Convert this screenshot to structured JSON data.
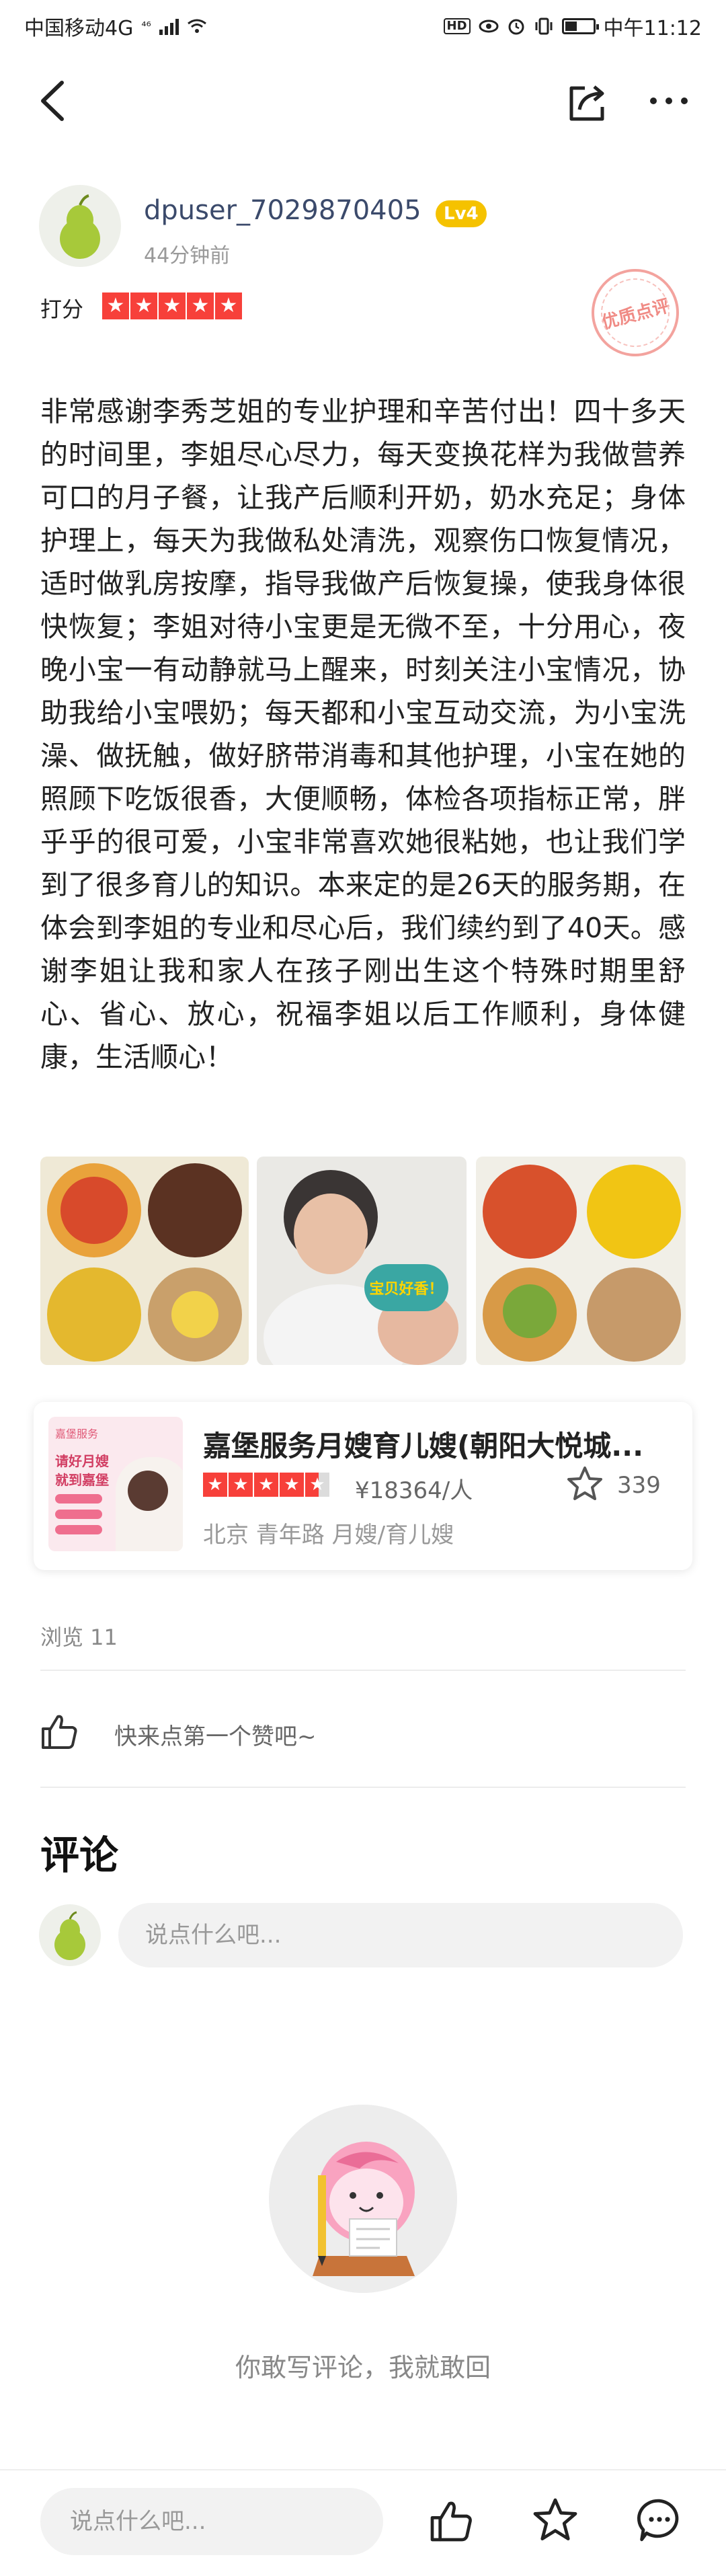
{
  "status_bar": {
    "carrier": "中国移动4G",
    "network": "⁴⁶",
    "time": "中午11:12",
    "hd": "HD"
  },
  "author": {
    "username": "dpuser_7029870405",
    "level": "Lv4",
    "time_ago": "44分钟前",
    "rating_label": "打分",
    "rating": 5,
    "stamp": "优质点评"
  },
  "review": {
    "text": "非常感谢李秀芝姐的专业护理和辛苦付出！四十多天的时间里，李姐尽心尽力，每天变换花样为我做营养可口的月子餐，让我产后顺利开奶，奶水充足；身体护理上，每天为我做私处清洗，观察伤口恢复情况，适时做乳房按摩，指导我做产后恢复操，使我身体很快恢复；李姐对待小宝更是无微不至，十分用心，夜晚小宝一有动静就马上醒来，时刻关注小宝情况，协助我给小宝喂奶；每天都和小宝互动交流，为小宝洗澡、做抚触，做好脐带消毒和其他护理，小宝在她的照顾下吃饭很香，大便顺畅，体检各项指标正常，胖乎乎的很可爱，小宝非常喜欢她很粘她，也让我们学到了很多育儿的知识。本来定的是26天的服务期，在体会到李姐的专业和尽心后，我们续约到了40天。感谢李姐让我和家人在孩子刚出生这个特殊时期里舒心、省心、放心，祝福李姐以后工作顺利，身体健康，生活顺心！"
  },
  "photos": {
    "bubble_text": "宝贝好香！"
  },
  "shop": {
    "name": "嘉堡服务月嫂育儿嫂(朝阳大悦城...",
    "rating": 4.5,
    "price": "¥18364/人",
    "favorites": "339",
    "location": "北京 青年路 月嫂/育儿嫂",
    "thumb_lines": [
      "请好月嫂",
      "就到嘉堡"
    ],
    "thumb_brand": "嘉堡服务"
  },
  "stats": {
    "views": "浏览 11",
    "like_prompt": "快来点第一个赞吧~"
  },
  "comments": {
    "title": "评论",
    "input_placeholder": "说点什么吧...",
    "empty_text": "你敢写评论，我就敢回"
  },
  "bottom_bar": {
    "input_placeholder": "说点什么吧..."
  },
  "colors": {
    "accent_red": "#f7403a",
    "level_badge": "#f5c200",
    "username": "#3b4a6b"
  },
  "icons": [
    "back-icon",
    "share-icon",
    "more-icon",
    "like-icon",
    "star-icon",
    "chat-icon"
  ]
}
